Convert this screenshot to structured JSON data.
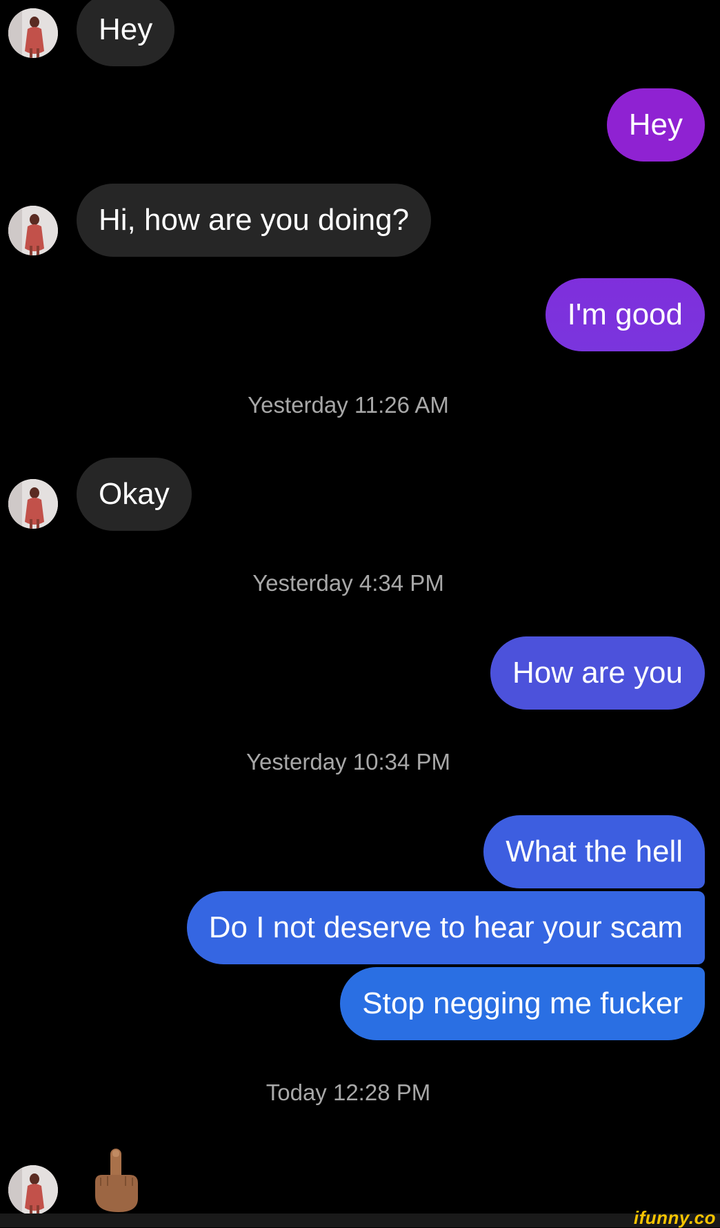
{
  "messages": {
    "m1": "Hey",
    "m2": "Hey",
    "m3": "Hi, how are you doing?",
    "m4": "I'm good",
    "ts1": "Yesterday 11:26 AM",
    "m5": "Okay",
    "ts2": "Yesterday 4:34 PM",
    "m6": "How are you",
    "ts3": "Yesterday 10:34 PM",
    "m7": "What the hell",
    "m8": "Do I not deserve to hear your scam",
    "m9": "Stop negging me fucker",
    "ts4": "Today 12:28 PM",
    "m10_icon": "middle-finger-emoji"
  },
  "colors": {
    "incoming": "#262626",
    "outgoing_gradient": [
      "#8f22d2",
      "#7d32de",
      "#4c53db",
      "#3d5ee0",
      "#3566e2",
      "#2a6fe3"
    ],
    "timestamp": "#a8a8a8"
  },
  "watermark": "ifunny.co"
}
